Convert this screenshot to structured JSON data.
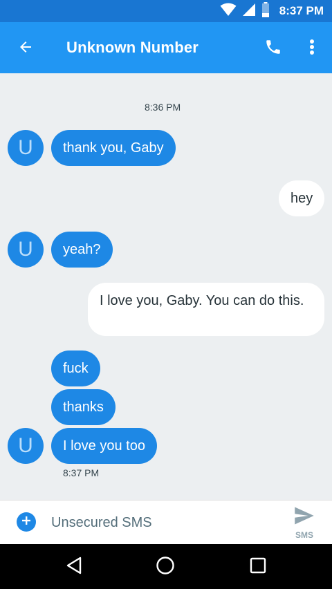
{
  "status_bar": {
    "time": "8:37 PM",
    "icons": [
      "wifi-icon",
      "signal-icon",
      "battery-icon"
    ]
  },
  "app_bar": {
    "title": "Unknown Number",
    "icons": [
      "back-arrow-icon",
      "phone-icon",
      "more-vert-icon"
    ]
  },
  "conversation": {
    "avatar_letter": "U",
    "messages": [
      {
        "type": "timestamp",
        "text": "8:36 PM"
      },
      {
        "direction": "incoming",
        "text": "thank you, Gaby"
      },
      {
        "direction": "outgoing",
        "text": "hey"
      },
      {
        "direction": "incoming",
        "text": "yeah?"
      },
      {
        "direction": "outgoing",
        "text": "I love you, Gaby. You can do this."
      },
      {
        "direction": "incoming",
        "text": "fuck"
      },
      {
        "direction": "incoming",
        "text": "thanks"
      },
      {
        "direction": "incoming",
        "text": "I love you too"
      },
      {
        "type": "timestamp",
        "text": "8:37 PM"
      }
    ]
  },
  "compose": {
    "placeholder": "Unsecured SMS",
    "send_label": "SMS"
  },
  "nav_bar": {
    "icons": [
      "back-nav-icon",
      "home-nav-icon",
      "recents-nav-icon"
    ]
  },
  "colors": {
    "status_bar": "#1976d2",
    "app_bar": "#2196f3",
    "incoming_bubble": "#1e88e5",
    "outgoing_bubble": "#ffffff",
    "background": "#eceff1"
  }
}
